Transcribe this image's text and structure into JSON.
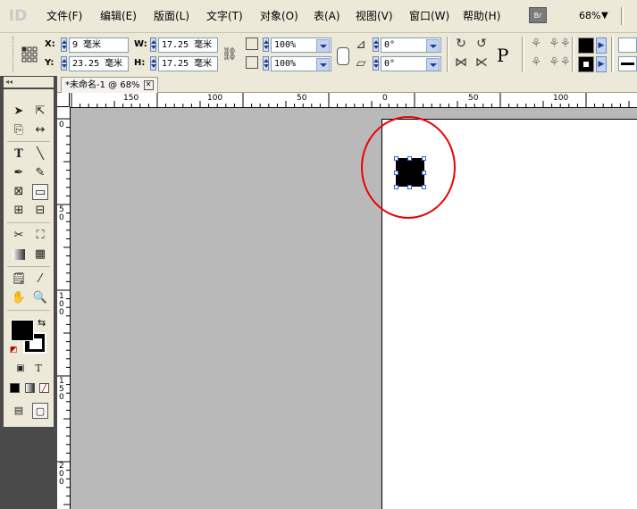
{
  "app": {
    "logo": "ID"
  },
  "menu": {
    "items": [
      "文件(F)",
      "编辑(E)",
      "版面(L)",
      "文字(T)",
      "对象(O)",
      "表(A)",
      "视图(V)",
      "窗口(W)",
      "帮助(H)"
    ],
    "bridge_label": "Br",
    "zoom": "68%"
  },
  "control": {
    "x_label": "X:",
    "x_value": "9 毫米",
    "y_label": "Y:",
    "y_value": "23.25 毫米",
    "w_label": "W:",
    "w_value": "17.25 毫米",
    "h_label": "H:",
    "h_value": "17.25 毫米",
    "scale_x": "100%",
    "scale_y": "100%",
    "rotate": "0°",
    "shear": "0°",
    "p_label": "P"
  },
  "document": {
    "tab_title": "*未命名-1 @ 68%",
    "close_glyph": "✕"
  },
  "rulers": {
    "h_labels": [
      "150",
      "100",
      "50",
      "0",
      "50",
      "100"
    ],
    "v_labels": [
      "0",
      "5\n0",
      "1\n0\n0",
      "1\n5\n0",
      "2\n0\n0"
    ]
  },
  "toolbox": {
    "collapse_glyph": "◂◂"
  },
  "colors": {
    "annotation_circle": "#e00000",
    "pasteboard": "#b9b9b9",
    "selection_handle": "#3366cc"
  }
}
